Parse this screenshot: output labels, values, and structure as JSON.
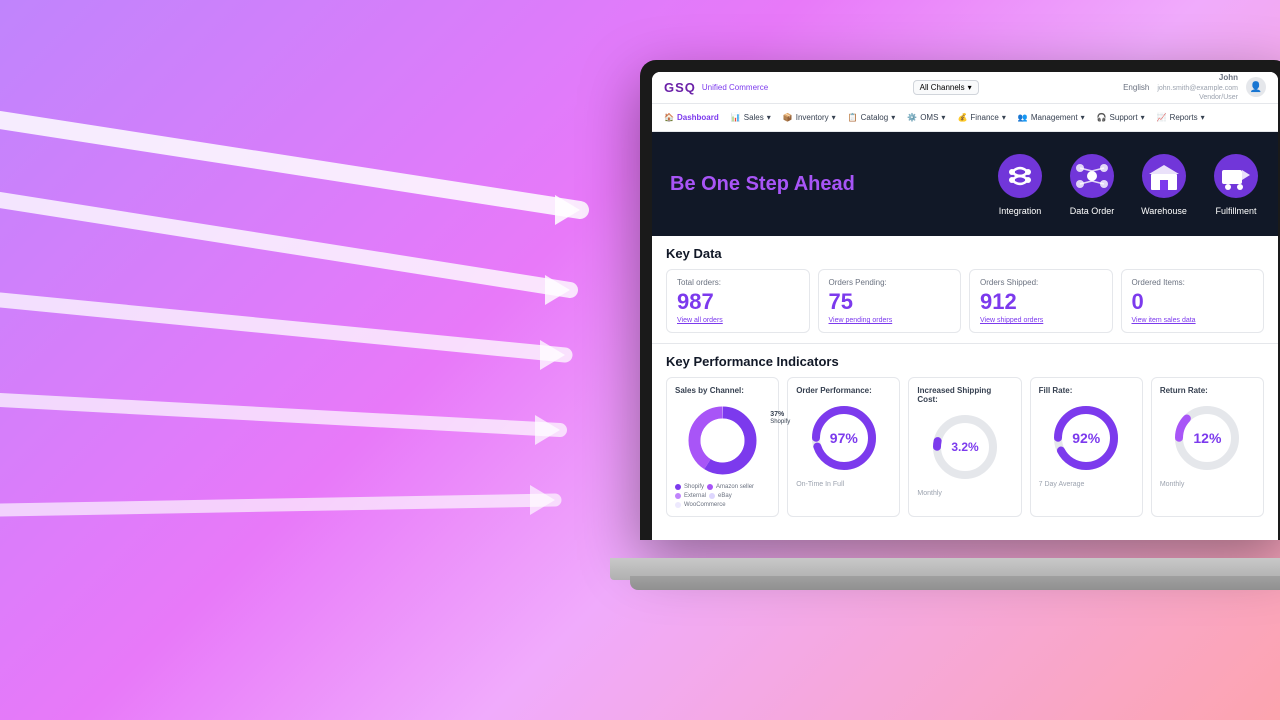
{
  "background": {
    "gradient_start": "#c084fc",
    "gradient_end": "#fda4af"
  },
  "header": {
    "logo": "GSQ",
    "logo_sub": "Unified Commerce",
    "channels_label": "All Channels",
    "language": "English",
    "user_name": "John",
    "user_email": "john.smith@example.com",
    "user_role": "Vendor/User"
  },
  "nav": {
    "items": [
      {
        "label": "Dashboard",
        "icon": "🏠",
        "active": true
      },
      {
        "label": "Sales",
        "icon": "📊",
        "active": false
      },
      {
        "label": "Inventory",
        "icon": "📦",
        "active": false
      },
      {
        "label": "Catalog",
        "icon": "📋",
        "active": false
      },
      {
        "label": "OMS",
        "icon": "⚙️",
        "active": false
      },
      {
        "label": "Finance",
        "icon": "💰",
        "active": false
      },
      {
        "label": "Management",
        "icon": "👥",
        "active": false
      },
      {
        "label": "Support",
        "icon": "🎧",
        "active": false
      },
      {
        "label": "Reports",
        "icon": "📈",
        "active": false
      }
    ]
  },
  "hero": {
    "title_main": "Be One Step ",
    "title_accent": "Ahead",
    "modules": [
      {
        "label": "Integration",
        "icon": "integration"
      },
      {
        "label": "Data Order",
        "icon": "data-order"
      },
      {
        "label": "Warehouse",
        "icon": "warehouse"
      },
      {
        "label": "Fulfillment",
        "icon": "fulfillment"
      }
    ]
  },
  "key_data": {
    "section_title": "Key Data",
    "cards": [
      {
        "label": "Total orders:",
        "value": "987",
        "link": "View all orders"
      },
      {
        "label": "Orders Pending:",
        "value": "75",
        "link": "View pending orders"
      },
      {
        "label": "Orders Shipped:",
        "value": "912",
        "link": "View shipped orders"
      },
      {
        "label": "Ordered Items:",
        "value": "0",
        "link": "View item sales data"
      }
    ]
  },
  "kpi": {
    "section_title": "Key Performance Indicators",
    "cards": [
      {
        "label": "Sales by Channel:",
        "type": "donut",
        "annotation": "37% Shopify",
        "legend": [
          {
            "color": "#7c3aed",
            "label": "Shopify"
          },
          {
            "color": "#a855f7",
            "label": "Amazon seller"
          },
          {
            "color": "#c084fc",
            "label": "External"
          },
          {
            "color": "#ddd6fe",
            "label": "eBay"
          },
          {
            "color": "#d8b4fe",
            "label": "WooCommerce"
          }
        ]
      },
      {
        "label": "Order Performance:",
        "type": "circle",
        "value": "97%",
        "sublabel": "On-Time In Full"
      },
      {
        "label": "Increased Shipping Cost:",
        "type": "circle",
        "value": "3.2%",
        "sublabel": "Monthly"
      },
      {
        "label": "Fill Rate:",
        "type": "circle",
        "value": "92%",
        "sublabel": "7 Day Average"
      },
      {
        "label": "Return Rate:",
        "type": "circle",
        "value": "12%",
        "sublabel": "Monthly"
      }
    ]
  }
}
